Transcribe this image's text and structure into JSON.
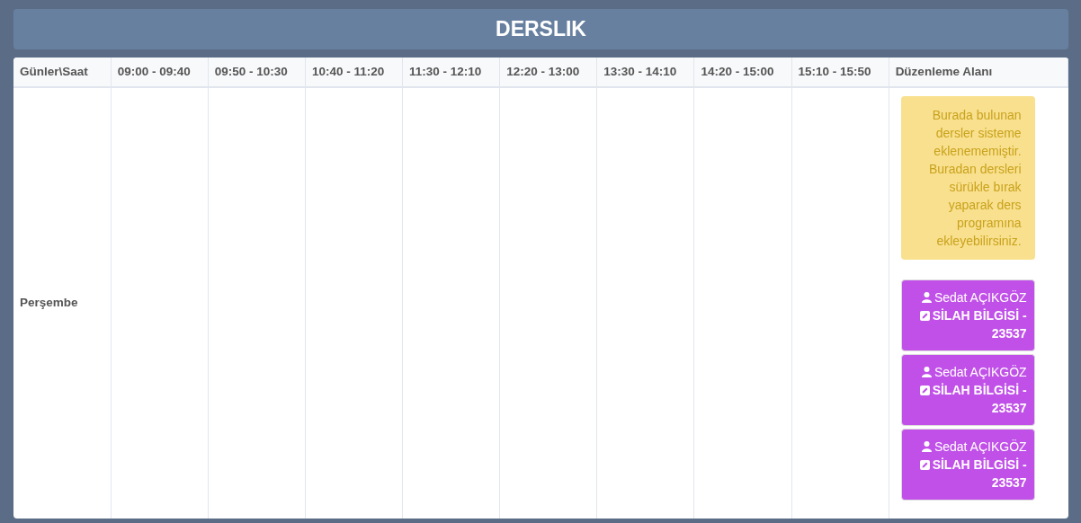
{
  "title": "DERSLIK",
  "columns": [
    "Günler\\Saat",
    "09:00 - 09:40",
    "09:50 - 10:30",
    "10:40 - 11:20",
    "11:30 - 12:10",
    "12:20 - 13:00",
    "13:30 - 14:10",
    "14:20 - 15:00",
    "15:10 - 15:50",
    "Düzenleme Alanı"
  ],
  "rows": [
    {
      "day": "Perşembe"
    }
  ],
  "notice": "Burada bulunan dersler sisteme eklenememiştir. Buradan dersleri sürükle bırak yaparak ders programına ekleyebilirsiniz.",
  "lessons": [
    {
      "teacher": "Sedat AÇIKGÖZ",
      "course": "SİLAH BİLGİSİ - 23537",
      "color": "#c050e8"
    },
    {
      "teacher": "Sedat AÇIKGÖZ",
      "course": "SİLAH BİLGİSİ - 23537",
      "color": "#c050e8"
    },
    {
      "teacher": "Sedat AÇIKGÖZ",
      "course": "SİLAH BİLGİSİ - 23537",
      "color": "#c050e8"
    }
  ]
}
